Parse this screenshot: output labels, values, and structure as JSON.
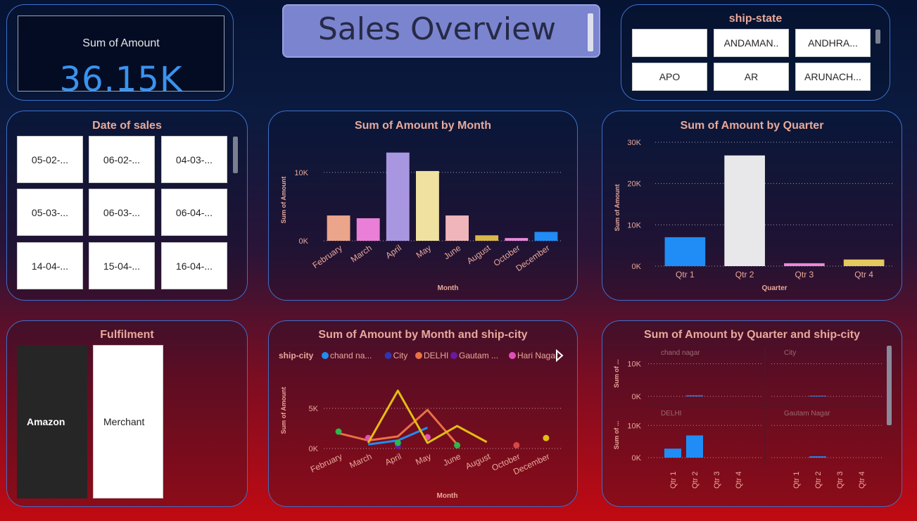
{
  "kpi": {
    "label": "Sum of Amount",
    "value": "36.15K"
  },
  "header": {
    "title": "Sales Overview"
  },
  "ship_state": {
    "title": "ship-state",
    "items": [
      "",
      "ANDAMAN..",
      "ANDHRA...",
      "APO",
      "AR",
      "ARUNACH..."
    ]
  },
  "date_of_sales": {
    "title": "Date of sales",
    "items": [
      "05-02-...",
      "06-02-...",
      "04-03-...",
      "05-03-...",
      "06-03-...",
      "06-04-...",
      "14-04-...",
      "15-04-...",
      "16-04-..."
    ]
  },
  "fulfilment": {
    "title": "Fulfilment",
    "options": [
      "Amazon",
      "Merchant"
    ],
    "selected": "Amazon"
  },
  "colors": {
    "accent": "#3a93ee",
    "title_text": "#e8a99b",
    "card_border": "#3d6fc9"
  },
  "chart_data": [
    {
      "id": "by_month",
      "type": "bar",
      "title": "Sum of Amount by Month",
      "xlabel": "Month",
      "ylabel": "Sum of Amount",
      "categories": [
        "February",
        "March",
        "April",
        "May",
        "June",
        "August",
        "October",
        "December"
      ],
      "values": [
        3700,
        3300,
        12900,
        10200,
        3700,
        800,
        400,
        1300
      ],
      "bar_colors": [
        "#eba58a",
        "#e97fd6",
        "#a996e0",
        "#f0e1a0",
        "#f0b5bb",
        "#d9b84a",
        "#e989d8",
        "#1f8df5"
      ],
      "ylim": [
        0,
        14000
      ],
      "yticks": [
        0,
        10000
      ],
      "ytick_labels": [
        "0K",
        "10K"
      ],
      "grid": true
    },
    {
      "id": "by_quarter",
      "type": "bar",
      "title": "Sum of Amount by Quarter",
      "xlabel": "Quarter",
      "ylabel": "Sum of Amount",
      "categories": [
        "Qtr 1",
        "Qtr 2",
        "Qtr 3",
        "Qtr 4"
      ],
      "values": [
        7000,
        26800,
        700,
        1600
      ],
      "bar_colors": [
        "#1f8df5",
        "#e8e8ea",
        "#e989d8",
        "#e4c95f"
      ],
      "ylim": [
        0,
        30000
      ],
      "yticks": [
        0,
        10000,
        20000,
        30000
      ],
      "ytick_labels": [
        "0K",
        "10K",
        "20K",
        "30K"
      ],
      "grid": true
    },
    {
      "id": "month_city",
      "type": "line",
      "title": "Sum of Amount by Month and ship-city",
      "xlabel": "Month",
      "ylabel": "Sum of Amount",
      "legend_title": "ship-city",
      "legend_position": "top",
      "categories": [
        "February",
        "March",
        "April",
        "May",
        "June",
        "August",
        "October",
        "December"
      ],
      "series": [
        {
          "name": "chand na...",
          "color": "#1f8df5",
          "values": [
            null,
            500,
            1000,
            2600,
            null,
            null,
            null,
            null
          ]
        },
        {
          "name": "City",
          "color": "#2f35b5",
          "values": [
            null,
            null,
            600,
            null,
            null,
            null,
            null,
            null
          ]
        },
        {
          "name": "DELHI",
          "color": "#ea7045",
          "values": [
            1900,
            1000,
            1500,
            4800,
            500,
            null,
            null,
            null
          ]
        },
        {
          "name": "Gautam ...",
          "color": "#6a1aa1",
          "values": [
            null,
            null,
            300,
            null,
            null,
            null,
            null,
            null
          ]
        },
        {
          "name": "Hari Nagar",
          "color": "#e04fb8",
          "values": [
            null,
            1300,
            null,
            1400,
            null,
            null,
            null,
            null
          ]
        },
        {
          "name": "",
          "color": "#e3bd12",
          "values": [
            null,
            700,
            7200,
            700,
            2800,
            800,
            null,
            1300
          ]
        },
        {
          "name": "",
          "color": "#2cb84c",
          "values": [
            2100,
            null,
            700,
            null,
            400,
            null,
            null,
            null
          ]
        },
        {
          "name": "",
          "color": "#d64646",
          "values": [
            null,
            null,
            null,
            null,
            null,
            null,
            400,
            null
          ]
        }
      ],
      "ylim": [
        0,
        8500
      ],
      "yticks": [
        0,
        5000
      ],
      "ytick_labels": [
        "0K",
        "5K"
      ],
      "grid": true
    },
    {
      "id": "quarter_city",
      "type": "bar",
      "title": "Sum of Amount by Quarter and ship-city",
      "ylabel": "Sum of ...",
      "categories": [
        "Qtr 1",
        "Qtr 2",
        "Qtr 3",
        "Qtr 4"
      ],
      "panels": [
        {
          "name": "chand nagar",
          "values": [
            0,
            300,
            0,
            0
          ]
        },
        {
          "name": "City",
          "values": [
            0,
            200,
            0,
            0
          ]
        },
        {
          "name": "DELHI",
          "values": [
            2800,
            6900,
            0,
            0
          ]
        },
        {
          "name": "Gautam Nagar",
          "values": [
            0,
            400,
            0,
            0
          ]
        }
      ],
      "ylim": [
        0,
        14000
      ],
      "yticks": [
        0,
        10000
      ],
      "ytick_labels": [
        "0K",
        "10K"
      ],
      "bar_color": "#1f8df5",
      "grid": true
    }
  ]
}
